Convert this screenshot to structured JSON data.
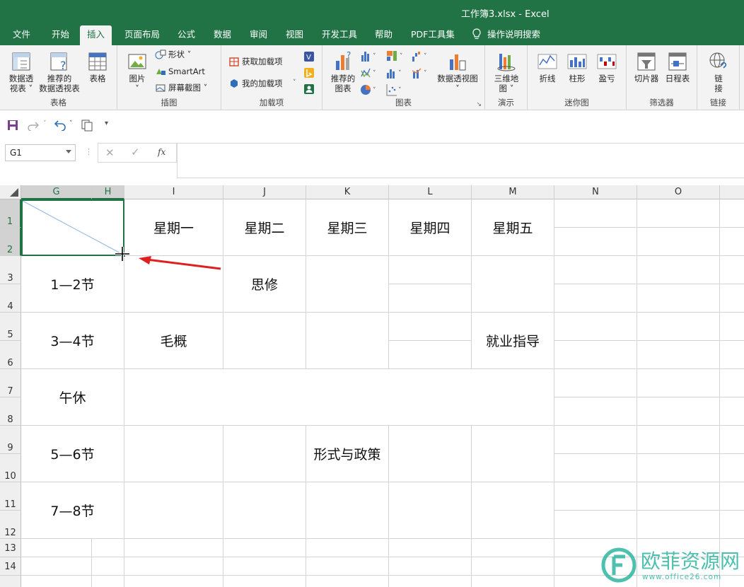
{
  "window": {
    "title": "工作簿3.xlsx  -  Excel"
  },
  "tabs": [
    {
      "label": "文件"
    },
    {
      "label": "开始"
    },
    {
      "label": "插入",
      "active": true
    },
    {
      "label": "页面布局"
    },
    {
      "label": "公式"
    },
    {
      "label": "数据"
    },
    {
      "label": "审阅"
    },
    {
      "label": "视图"
    },
    {
      "label": "开发工具"
    },
    {
      "label": "帮助"
    },
    {
      "label": "PDF工具集"
    }
  ],
  "search": {
    "label": "操作说明搜索",
    "icon": "lightbulb-icon"
  },
  "ribbon": {
    "tables": {
      "label": "表格",
      "pivot": "数据透\n视表 ˅",
      "recommended_pivot": "推荐的\n数据透视表",
      "table": "表格"
    },
    "illustrations": {
      "label": "插图",
      "pictures": "图片\n˅",
      "shapes": "形状 ˅",
      "smartart": "SmartArt",
      "screenshot": "屏幕截图 ˅"
    },
    "addins": {
      "label": "加载项",
      "get": "获取加载项",
      "mine": "我的加载项"
    },
    "charts": {
      "label": "图表",
      "recommended": "推荐的\n图表",
      "pivot_chart": "数据透视图\n˅"
    },
    "tours": {
      "label": "演示",
      "map3d": "三维地\n图 ˅"
    },
    "sparklines": {
      "label": "迷你图",
      "line": "折线",
      "column": "柱形",
      "winloss": "盈亏"
    },
    "filters": {
      "label": "筛选器",
      "slicer": "切片器",
      "timeline": "日程表"
    },
    "links": {
      "label": "链接",
      "link": "链\n接"
    }
  },
  "formula_bar": {
    "namebox": "G1",
    "fx": "fx",
    "value": ""
  },
  "columns": [
    "G",
    "H",
    "I",
    "J",
    "K",
    "L",
    "M",
    "N",
    "O"
  ],
  "rows": [
    "1",
    "2",
    "3",
    "4",
    "5",
    "6",
    "7",
    "8",
    "9",
    "10",
    "11",
    "12",
    "13",
    "14"
  ],
  "timetable": {
    "days": [
      "星期一",
      "星期二",
      "星期三",
      "星期四",
      "星期五"
    ],
    "periods": [
      "1—2节",
      "3—4节",
      "午休",
      "5—6节",
      "7—8节"
    ],
    "classes": {
      "siyou": "思修",
      "maogai": "毛概",
      "jiuye": "就业指导",
      "xingshi": "形式与政策"
    }
  },
  "watermark": {
    "text": "欧菲资源网",
    "sub": "www.office26.com"
  },
  "colors": {
    "accent": "#217346",
    "arrow": "#e02020"
  }
}
